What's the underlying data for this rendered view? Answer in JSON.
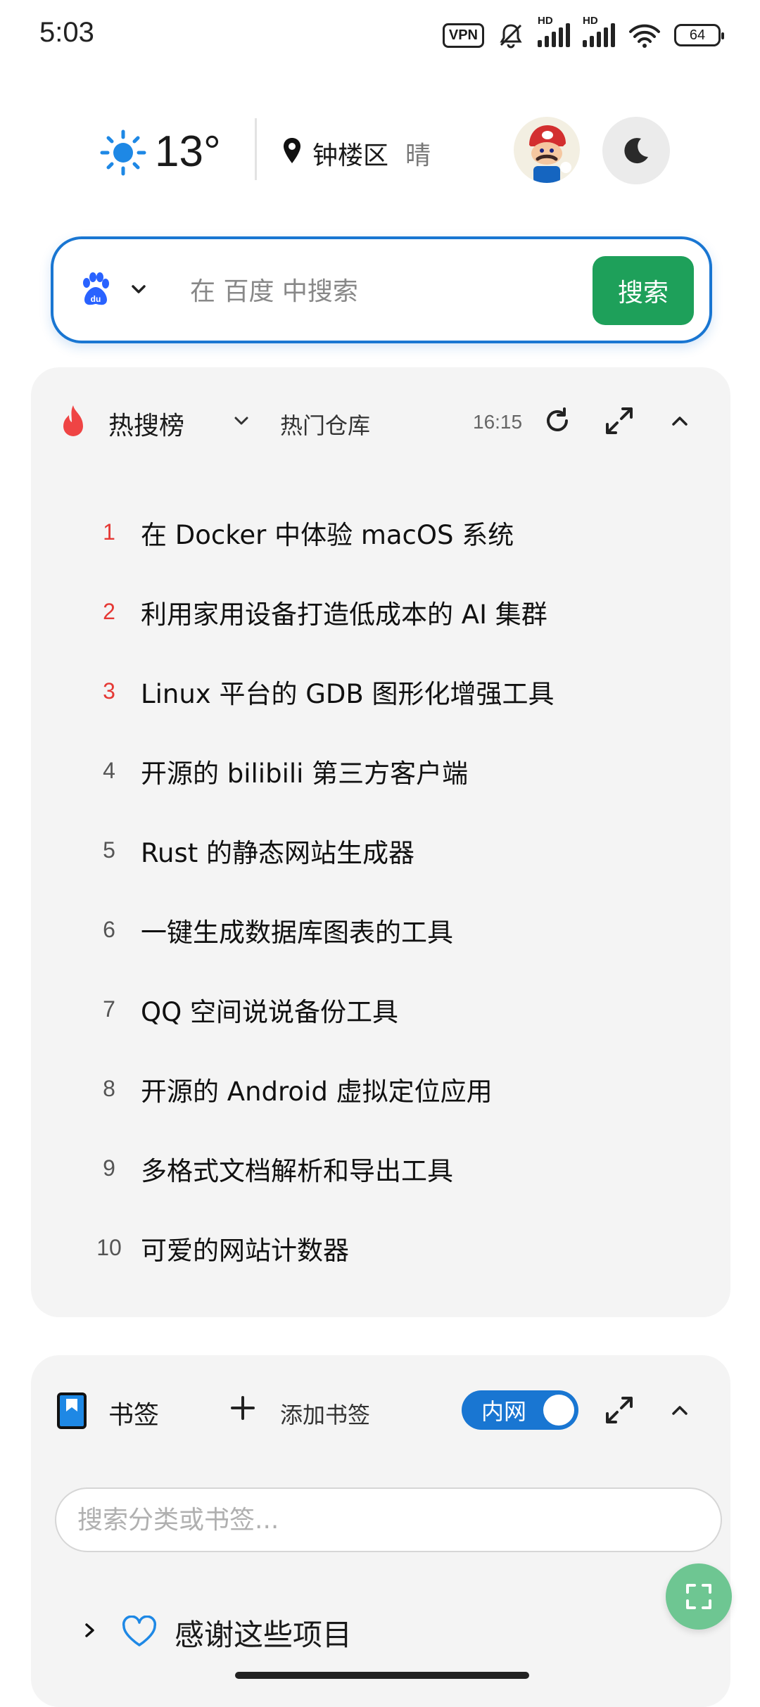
{
  "status_bar": {
    "time": "5:03",
    "vpn_label": "VPN",
    "hd_label": "HD",
    "battery": "64"
  },
  "weather": {
    "temperature": "13°",
    "district": "钟楼区",
    "condition": "晴",
    "icon": "sun-icon"
  },
  "search": {
    "engine_icon": "baidu-paw-icon",
    "placeholder": "在 百度 中搜索",
    "button_label": "搜索",
    "accent_color": "#1976d2",
    "button_color": "#1ea05a"
  },
  "hot": {
    "title": "热搜榜",
    "source": "热门仓库",
    "time": "16:15",
    "items": [
      {
        "rank": "1",
        "text": "在 Docker 中体验 macOS 系统"
      },
      {
        "rank": "2",
        "text": "利用家用设备打造低成本的 AI 集群"
      },
      {
        "rank": "3",
        "text": "Linux 平台的 GDB 图形化增强工具"
      },
      {
        "rank": "4",
        "text": "开源的 bilibili 第三方客户端"
      },
      {
        "rank": "5",
        "text": "Rust 的静态网站生成器"
      },
      {
        "rank": "6",
        "text": "一键生成数据库图表的工具"
      },
      {
        "rank": "7",
        "text": "QQ 空间说说备份工具"
      },
      {
        "rank": "8",
        "text": "开源的 Android 虚拟定位应用"
      },
      {
        "rank": "9",
        "text": "多格式文档解析和导出工具"
      },
      {
        "rank": "10",
        "text": "可爱的网站计数器"
      }
    ],
    "top_rank_color": "#e53935"
  },
  "bookmarks": {
    "title": "书签",
    "add_label": "添加书签",
    "toggle_label": "内网",
    "toggle_on": true,
    "search_placeholder": "搜索分类或书签...",
    "group_label": "感谢这些项目"
  }
}
